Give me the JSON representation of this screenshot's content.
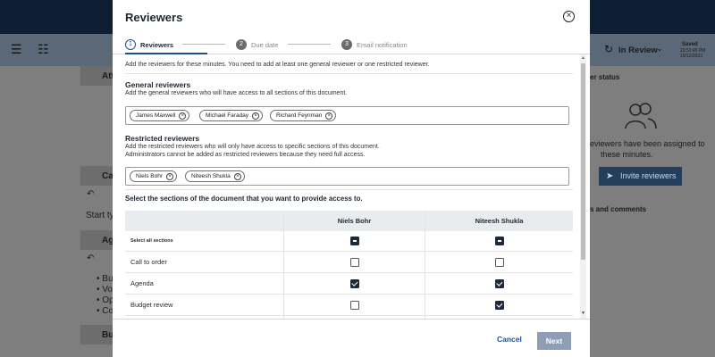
{
  "background": {
    "toolbar": {
      "status_label": "In Review",
      "saved_label": "Saved",
      "saved_time": "10:52:45 PM",
      "saved_date": "10/12/2023"
    },
    "left_panel": {
      "partial_labels": [
        "Att",
        "Ca",
        "Start typ",
        "Ag",
        "Bu"
      ],
      "bullets": [
        "Bu",
        "Vo",
        "Op",
        "Co"
      ]
    },
    "right_panel": {
      "status_title": "er status",
      "empty_text_line1": "eviewers have been assigned to",
      "empty_text_line2": "these minutes.",
      "invite_label": "Invite reviewers",
      "tasks_label": "s and comments"
    }
  },
  "modal": {
    "title": "Reviewers",
    "steps": [
      {
        "num": "1",
        "label": "Reviewers",
        "state": "active"
      },
      {
        "num": "2",
        "label": "Due date",
        "state": "idle"
      },
      {
        "num": "3",
        "label": "Email notification",
        "state": "idle"
      }
    ],
    "intro": "Add the reviewers for these minutes. You need to add at least one general reviewer or one restricted reviewer.",
    "general": {
      "title": "General reviewers",
      "desc": "Add the general reviewers who will have access to all sections of this document.",
      "chips": [
        "James Maxwell",
        "Michael Faraday",
        "Richard Feynman"
      ]
    },
    "restricted": {
      "title": "Restricted reviewers",
      "desc1": "Add the restricted reviewers who will only have access to specific sections of this document.",
      "desc2": "Administrators cannot be added as restricted reviewers because they need full access.",
      "chips": [
        "Niels Bohr",
        "Niteesh Shukla"
      ]
    },
    "sections": {
      "title": "Select the sections of the document that you want to provide access to.",
      "columns": [
        "",
        "Niels Bohr",
        "Niteesh Shukla"
      ],
      "select_all_label": "Select all sections",
      "rows": [
        {
          "label": "Call to order",
          "niels": false,
          "niteesh": false
        },
        {
          "label": "Agenda",
          "niels": true,
          "niteesh": true
        },
        {
          "label": "Budget review",
          "niels": false,
          "niteesh": true
        }
      ]
    },
    "footer": {
      "cancel_label": "Cancel",
      "next_label": "Next"
    }
  }
}
